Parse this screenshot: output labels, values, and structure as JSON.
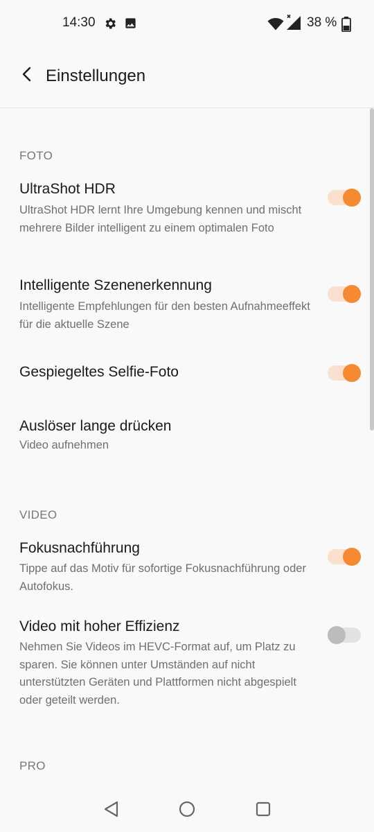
{
  "status_bar": {
    "time": "14:30",
    "battery_percent": "38 %",
    "icons": [
      "gear-icon",
      "image-icon",
      "wifi-icon",
      "signal-icon",
      "battery-icon"
    ]
  },
  "app_bar": {
    "title": "Einstellungen",
    "back_icon": "chevron-left-icon"
  },
  "sections": {
    "foto": {
      "header": "FOTO",
      "items": [
        {
          "title": "UltraShot HDR",
          "description": "UltraShot HDR lernt Ihre Umgebung kennen und mischt mehrere Bilder intelligent zu einem optimalen Foto",
          "toggle_on": true
        },
        {
          "title": "Intelligente Szenenerkennung",
          "description": "Intelligente Empfehlungen für den besten Aufnahmeeffekt für die aktuelle Szene",
          "toggle_on": true
        },
        {
          "title": "Gespiegeltes Selfie-Foto",
          "toggle_on": true
        },
        {
          "title": "Auslöser lange drücken",
          "description": "Video aufnehmen"
        }
      ]
    },
    "video": {
      "header": "VIDEO",
      "items": [
        {
          "title": "Fokusnachführung",
          "description": "Tippe auf das Motiv für sofortige Fokusnachführung oder Autofokus.",
          "toggle_on": true
        },
        {
          "title": "Video mit hoher Effizienz",
          "description": "Nehmen Sie Videos im HEVC-Format auf, um Platz zu sparen. Sie können unter Umständen auf nicht unterstützten Geräten und Plattformen nicht abgespielt oder geteilt werden.",
          "toggle_on": false
        }
      ]
    },
    "pro": {
      "header": "PRO"
    }
  },
  "colors": {
    "accent": "#f58a33",
    "accent_track": "#fbe0cf",
    "background": "#f9f9f9",
    "secondary_text": "#6f6f6f"
  },
  "nav_bar": {
    "icons": [
      "back-triangle-icon",
      "home-circle-icon",
      "recents-square-icon"
    ]
  }
}
